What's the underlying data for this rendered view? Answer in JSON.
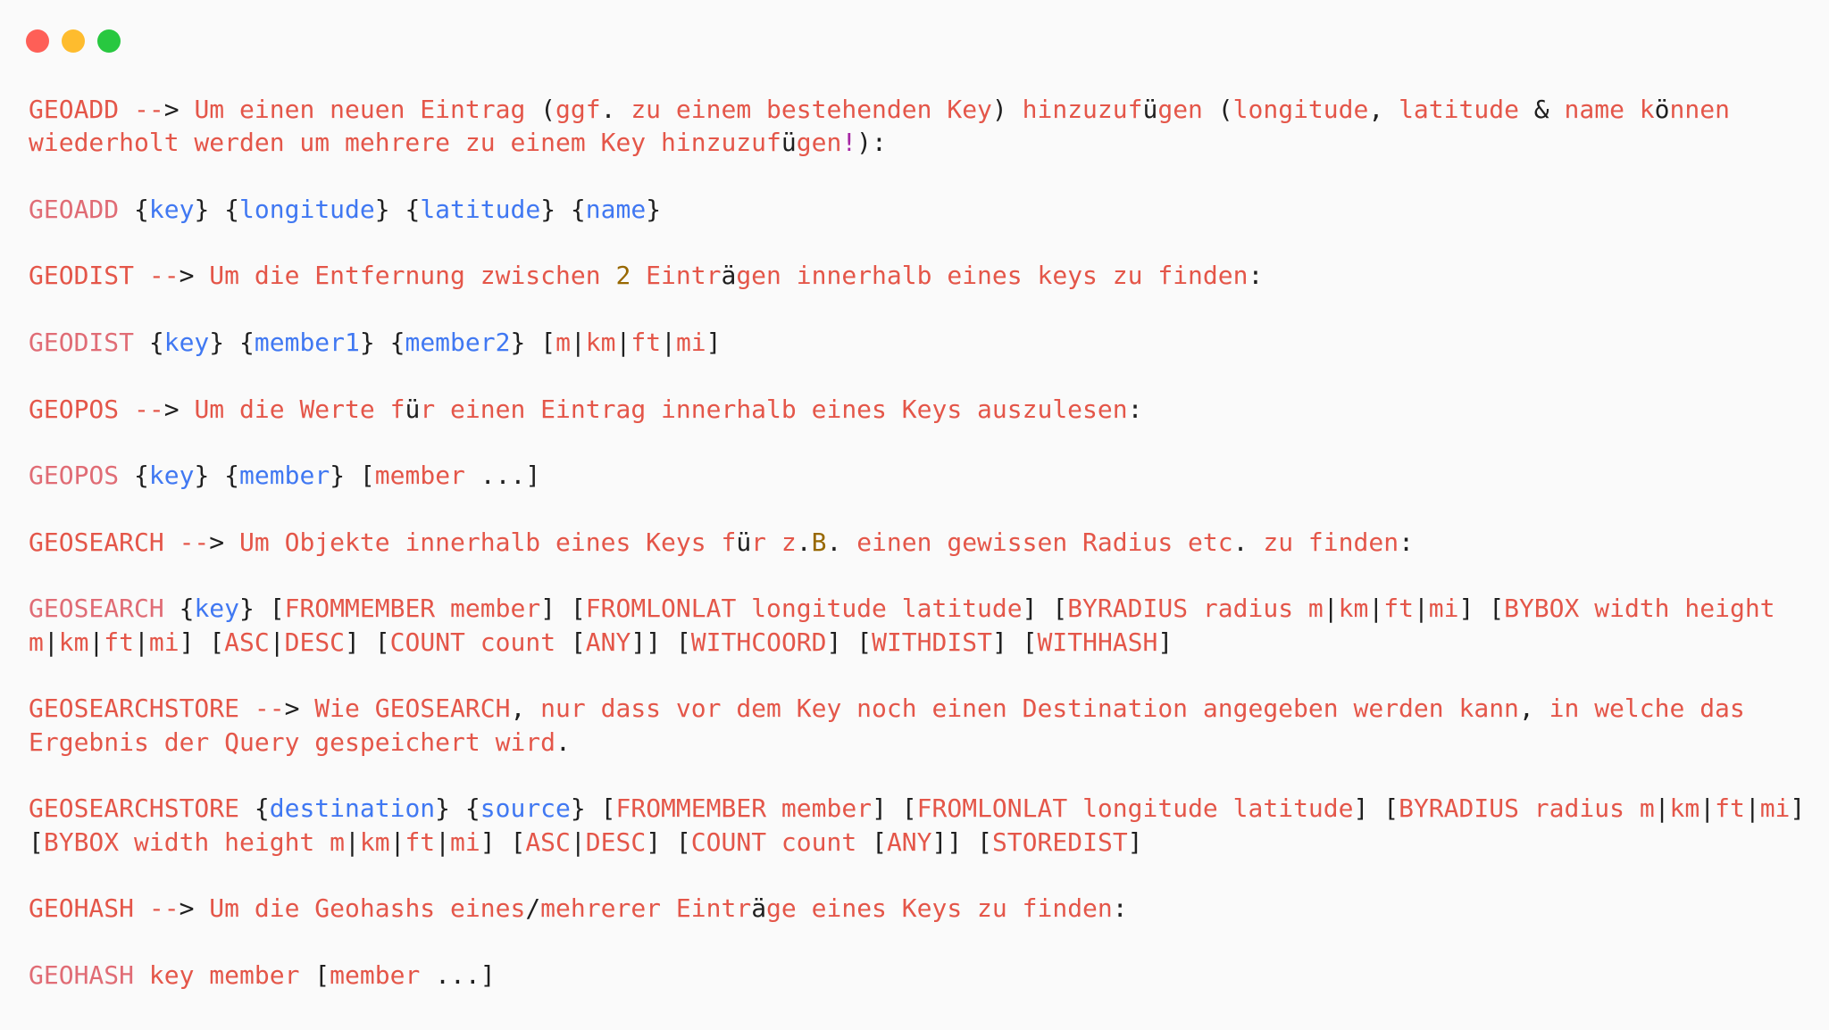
{
  "window": {
    "buttons": [
      {
        "name": "close",
        "color": "#fe5f57"
      },
      {
        "name": "minimize",
        "color": "#febc2e"
      },
      {
        "name": "maximize",
        "color": "#28c840"
      }
    ]
  },
  "colors": {
    "keyword": "#e45649",
    "keyword_light": "#e06c75",
    "placeholder": "#4078f2",
    "number": "#986801",
    "punct": "#1f1f1f",
    "exclaim": "#a626a4"
  },
  "blocks": [
    {
      "segments": [
        [
          "GEOADD --",
          "keyword"
        ],
        [
          "> ",
          "punct"
        ],
        [
          "Um einen neuen Eintrag ",
          "keyword"
        ],
        [
          "(",
          "punct"
        ],
        [
          "ggf",
          "keyword"
        ],
        [
          ". ",
          "punct"
        ],
        [
          "zu einem bestehenden Key",
          "keyword"
        ],
        [
          ") ",
          "punct"
        ],
        [
          "hinzuzuf",
          "keyword"
        ],
        [
          "ü",
          "punct"
        ],
        [
          "gen ",
          "keyword"
        ],
        [
          "(",
          "punct"
        ],
        [
          "longitude",
          "keyword"
        ],
        [
          ", ",
          "punct"
        ],
        [
          "latitude ",
          "keyword"
        ],
        [
          "& ",
          "punct"
        ],
        [
          "name k",
          "keyword"
        ],
        [
          "ö",
          "punct"
        ],
        [
          "nnen wiederholt werden um mehrere zu einem Key hinzuzuf",
          "keyword"
        ],
        [
          "ü",
          "punct"
        ],
        [
          "gen",
          "keyword"
        ],
        [
          "!",
          "exclaim"
        ],
        [
          "):",
          "punct"
        ]
      ]
    },
    {
      "segments": [
        [
          "GEOADD ",
          "keyword_light"
        ],
        [
          "{",
          "punct"
        ],
        [
          "key",
          "placeholder"
        ],
        [
          "} {",
          "punct"
        ],
        [
          "longitude",
          "placeholder"
        ],
        [
          "} {",
          "punct"
        ],
        [
          "latitude",
          "placeholder"
        ],
        [
          "} {",
          "punct"
        ],
        [
          "name",
          "placeholder"
        ],
        [
          "}",
          "punct"
        ]
      ]
    },
    {
      "segments": [
        [
          "GEODIST --",
          "keyword"
        ],
        [
          "> ",
          "punct"
        ],
        [
          "Um die Entfernung zwischen ",
          "keyword"
        ],
        [
          "2",
          "number"
        ],
        [
          " Eintr",
          "keyword"
        ],
        [
          "ä",
          "punct"
        ],
        [
          "gen innerhalb eines keys zu finden",
          "keyword"
        ],
        [
          ":",
          "punct"
        ]
      ]
    },
    {
      "segments": [
        [
          "GEODIST ",
          "keyword_light"
        ],
        [
          "{",
          "punct"
        ],
        [
          "key",
          "placeholder"
        ],
        [
          "} {",
          "punct"
        ],
        [
          "member1",
          "placeholder"
        ],
        [
          "} {",
          "punct"
        ],
        [
          "member2",
          "placeholder"
        ],
        [
          "} [",
          "punct"
        ],
        [
          "m",
          "keyword"
        ],
        [
          "|",
          "punct"
        ],
        [
          "km",
          "keyword"
        ],
        [
          "|",
          "punct"
        ],
        [
          "ft",
          "keyword"
        ],
        [
          "|",
          "punct"
        ],
        [
          "mi",
          "keyword"
        ],
        [
          "]",
          "punct"
        ]
      ]
    },
    {
      "segments": [
        [
          "GEOPOS --",
          "keyword"
        ],
        [
          "> ",
          "punct"
        ],
        [
          "Um die Werte f",
          "keyword"
        ],
        [
          "ü",
          "punct"
        ],
        [
          "r einen Eintrag innerhalb eines Keys auszulesen",
          "keyword"
        ],
        [
          ":",
          "punct"
        ]
      ]
    },
    {
      "segments": [
        [
          "GEOPOS ",
          "keyword_light"
        ],
        [
          "{",
          "punct"
        ],
        [
          "key",
          "placeholder"
        ],
        [
          "} {",
          "punct"
        ],
        [
          "member",
          "placeholder"
        ],
        [
          "} [",
          "punct"
        ],
        [
          "member ",
          "keyword"
        ],
        [
          "...]",
          "punct"
        ]
      ]
    },
    {
      "segments": [
        [
          "GEOSEARCH --",
          "keyword"
        ],
        [
          "> ",
          "punct"
        ],
        [
          "Um Objekte innerhalb eines Keys f",
          "keyword"
        ],
        [
          "ü",
          "punct"
        ],
        [
          "r z",
          "keyword"
        ],
        [
          ".",
          "punct"
        ],
        [
          "B",
          "number"
        ],
        [
          ". ",
          "punct"
        ],
        [
          "einen gewissen Radius etc",
          "keyword"
        ],
        [
          ". ",
          "punct"
        ],
        [
          "zu finden",
          "keyword"
        ],
        [
          ":",
          "punct"
        ]
      ]
    },
    {
      "segments": [
        [
          "GEOSEARCH ",
          "keyword_light"
        ],
        [
          "{",
          "punct"
        ],
        [
          "key",
          "placeholder"
        ],
        [
          "} [",
          "punct"
        ],
        [
          "FROMMEMBER member",
          "keyword"
        ],
        [
          "] [",
          "punct"
        ],
        [
          "FROMLONLAT longitude latitude",
          "keyword"
        ],
        [
          "] [",
          "punct"
        ],
        [
          "BYRADIUS radius m",
          "keyword"
        ],
        [
          "|",
          "punct"
        ],
        [
          "km",
          "keyword"
        ],
        [
          "|",
          "punct"
        ],
        [
          "ft",
          "keyword"
        ],
        [
          "|",
          "punct"
        ],
        [
          "mi",
          "keyword"
        ],
        [
          "] [",
          "punct"
        ],
        [
          "BYBOX width height m",
          "keyword"
        ],
        [
          "|",
          "punct"
        ],
        [
          "km",
          "keyword"
        ],
        [
          "|",
          "punct"
        ],
        [
          "ft",
          "keyword"
        ],
        [
          "|",
          "punct"
        ],
        [
          "mi",
          "keyword"
        ],
        [
          "] [",
          "punct"
        ],
        [
          "ASC",
          "keyword"
        ],
        [
          "|",
          "punct"
        ],
        [
          "DESC",
          "keyword"
        ],
        [
          "] [",
          "punct"
        ],
        [
          "COUNT count ",
          "keyword"
        ],
        [
          "[",
          "punct"
        ],
        [
          "ANY",
          "keyword"
        ],
        [
          "]] [",
          "punct"
        ],
        [
          "WITHCOORD",
          "keyword"
        ],
        [
          "] [",
          "punct"
        ],
        [
          "WITHDIST",
          "keyword"
        ],
        [
          "] [",
          "punct"
        ],
        [
          "WITHHASH",
          "keyword"
        ],
        [
          "]",
          "punct"
        ]
      ]
    },
    {
      "segments": [
        [
          "GEOSEARCHSTORE --",
          "keyword"
        ],
        [
          "> ",
          "punct"
        ],
        [
          "Wie GEOSEARCH",
          "keyword"
        ],
        [
          ", ",
          "punct"
        ],
        [
          "nur dass vor dem Key noch einen Destination angegeben werden kann",
          "keyword"
        ],
        [
          ", ",
          "punct"
        ],
        [
          "in welche das Ergebnis der Query gespeichert wird",
          "keyword"
        ],
        [
          ".",
          "punct"
        ]
      ]
    },
    {
      "segments": [
        [
          "GEOSEARCHSTORE ",
          "keyword"
        ],
        [
          "{",
          "punct"
        ],
        [
          "destination",
          "placeholder"
        ],
        [
          "} {",
          "punct"
        ],
        [
          "source",
          "placeholder"
        ],
        [
          "} [",
          "punct"
        ],
        [
          "FROMMEMBER member",
          "keyword"
        ],
        [
          "] [",
          "punct"
        ],
        [
          "FROMLONLAT longitude latitude",
          "keyword"
        ],
        [
          "] [",
          "punct"
        ],
        [
          "BYRADIUS radius m",
          "keyword"
        ],
        [
          "|",
          "punct"
        ],
        [
          "km",
          "keyword"
        ],
        [
          "|",
          "punct"
        ],
        [
          "ft",
          "keyword"
        ],
        [
          "|",
          "punct"
        ],
        [
          "mi",
          "keyword"
        ],
        [
          "] [",
          "punct"
        ],
        [
          "BYBOX width height m",
          "keyword"
        ],
        [
          "|",
          "punct"
        ],
        [
          "km",
          "keyword"
        ],
        [
          "|",
          "punct"
        ],
        [
          "ft",
          "keyword"
        ],
        [
          "|",
          "punct"
        ],
        [
          "mi",
          "keyword"
        ],
        [
          "] [",
          "punct"
        ],
        [
          "ASC",
          "keyword"
        ],
        [
          "|",
          "punct"
        ],
        [
          "DESC",
          "keyword"
        ],
        [
          "] [",
          "punct"
        ],
        [
          "COUNT count ",
          "keyword"
        ],
        [
          "[",
          "punct"
        ],
        [
          "ANY",
          "keyword"
        ],
        [
          "]] [",
          "punct"
        ],
        [
          "STOREDIST",
          "keyword"
        ],
        [
          "]",
          "punct"
        ]
      ]
    },
    {
      "segments": [
        [
          "GEOHASH --",
          "keyword"
        ],
        [
          "> ",
          "punct"
        ],
        [
          "Um die Geohashs eines",
          "keyword"
        ],
        [
          "/",
          "punct"
        ],
        [
          "mehrerer Eintr",
          "keyword"
        ],
        [
          "ä",
          "punct"
        ],
        [
          "ge eines Keys zu finden",
          "keyword"
        ],
        [
          ":",
          "punct"
        ]
      ]
    },
    {
      "segments": [
        [
          "GEOHASH ",
          "keyword_light"
        ],
        [
          "key member ",
          "keyword"
        ],
        [
          "[",
          "punct"
        ],
        [
          "member ",
          "keyword"
        ],
        [
          "...]",
          "punct"
        ]
      ]
    }
  ]
}
